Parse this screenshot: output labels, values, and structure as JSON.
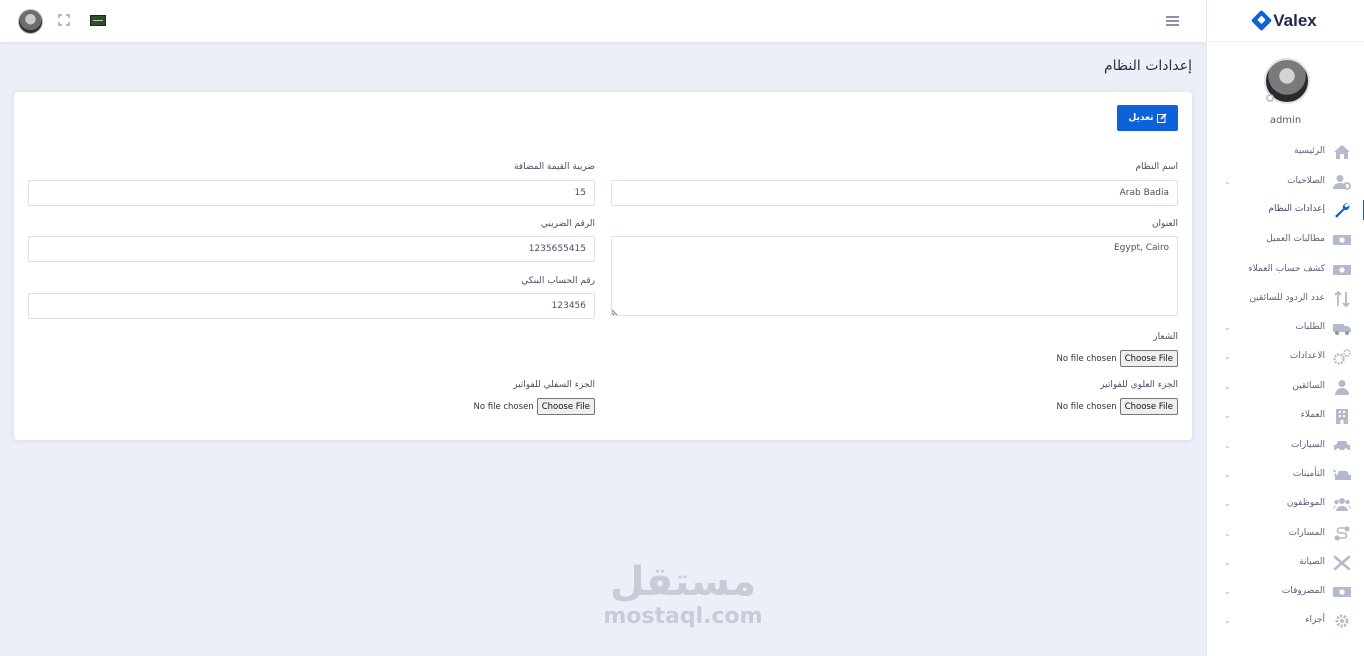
{
  "header": {
    "avatar_icon": "user-avatar",
    "fullscreen_icon": "fullscreen-icon",
    "language_icon": "flag-icon",
    "menu_icon": "hamburger-icon"
  },
  "sidebar": {
    "brand": "Valex",
    "profile_name": "admin",
    "items": [
      {
        "label": "الرئيسية",
        "icon": "home-icon",
        "has_submenu": false
      },
      {
        "label": "الصلاحيات",
        "icon": "user-cog-icon",
        "has_submenu": true
      },
      {
        "label": "إعدادات النظام",
        "icon": "wrench-icon",
        "has_submenu": false,
        "active": true
      },
      {
        "label": "مطالبات العميل",
        "icon": "money-icon",
        "has_submenu": false
      },
      {
        "label": "كشف حساب العملاء",
        "icon": "money-icon",
        "has_submenu": false
      },
      {
        "label": "عدد الردود للسائقين",
        "icon": "sort-icon",
        "has_submenu": false
      },
      {
        "label": "الطلبات",
        "icon": "truck-icon",
        "has_submenu": true
      },
      {
        "label": "الاعدادات",
        "icon": "cogs-icon",
        "has_submenu": true
      },
      {
        "label": "السائقين",
        "icon": "user-tie-icon",
        "has_submenu": true
      },
      {
        "label": "العملاء",
        "icon": "building-icon",
        "has_submenu": true
      },
      {
        "label": "السيارات",
        "icon": "car-icon",
        "has_submenu": true
      },
      {
        "label": "التأمينات",
        "icon": "car-crash-icon",
        "has_submenu": true
      },
      {
        "label": "الموظفون",
        "icon": "users-icon",
        "has_submenu": true
      },
      {
        "label": "المسارات",
        "icon": "route-icon",
        "has_submenu": true
      },
      {
        "label": "الصيانة",
        "icon": "tools-icon",
        "has_submenu": true
      },
      {
        "label": "المصروفات",
        "icon": "money-icon",
        "has_submenu": true
      },
      {
        "label": "أجزاء",
        "icon": "gear-icon",
        "has_submenu": true
      }
    ]
  },
  "page": {
    "title": "إعدادات النظام"
  },
  "form": {
    "edit_button": "تعديل",
    "system_name": {
      "label": "اسم النظام",
      "value": "Arab Badia"
    },
    "vat": {
      "label": "ضريبة القيمة المضافة",
      "value": "15"
    },
    "address": {
      "label": "العنوان",
      "value": "Egypt, Cairo"
    },
    "tax_number": {
      "label": "الرقم الضريبي",
      "value": "1235655415"
    },
    "bank_account": {
      "label": "رقم الحساب البنكي",
      "value": "123456"
    },
    "logo": {
      "label": "الشعار",
      "button": "Choose File",
      "status": "No file chosen"
    },
    "invoice_header": {
      "label": "الجزء العلوي للفواتير",
      "button": "Choose File",
      "status": "No file chosen"
    },
    "invoice_footer": {
      "label": "الجزء السفلي للفواتير",
      "button": "Choose File",
      "status": "No file chosen"
    }
  },
  "watermark": {
    "arabic": "مستقل",
    "latin": "mostaql.com"
  },
  "colors": {
    "primary": "#0c62d9",
    "background": "#eceff8",
    "card": "#ffffff"
  }
}
